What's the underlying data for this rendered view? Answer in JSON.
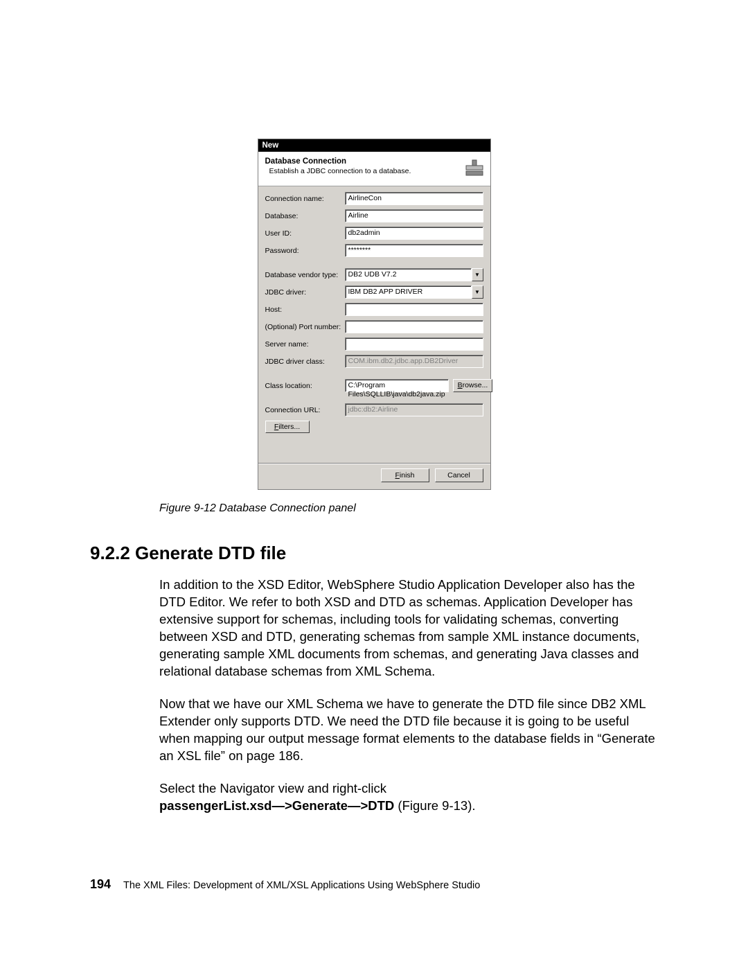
{
  "dialog": {
    "title": "New",
    "bannerTitle": "Database Connection",
    "bannerSubtitle": "Establish a JDBC connection to a database.",
    "labels": {
      "connName": "Connection name:",
      "database": "Database:",
      "userId": "User ID:",
      "password": "Password:",
      "vendor": "Database vendor type:",
      "jdbcDriver": "JDBC driver:",
      "host": "Host:",
      "port": "(Optional) Port number:",
      "server": "Server name:",
      "driverClass": "JDBC driver class:",
      "classLoc": "Class location:",
      "connUrl": "Connection URL:"
    },
    "values": {
      "connName": "AirlineCon",
      "database": "Airline",
      "userId": "db2admin",
      "password": "********",
      "vendor": "DB2 UDB V7.2",
      "jdbcDriver": "IBM DB2 APP DRIVER",
      "host": "",
      "port": "",
      "server": "",
      "driverClass": "COM.ibm.db2.jdbc.app.DB2Driver",
      "classLoc": "C:\\Program Files\\SQLLIB\\java\\db2java.zip",
      "connUrl": "jdbc:db2:Airline"
    },
    "buttons": {
      "browse": "Browse...",
      "filters": "Filters...",
      "finishPrefix": "F",
      "finishRest": "inish",
      "cancel": "Cancel"
    }
  },
  "figureCaption": "Figure 9-12   Database Connection panel",
  "sectionHeading": "9.2.2  Generate DTD file",
  "para1": "In addition to the XSD Editor, WebSphere Studio Application Developer also has the DTD Editor. We refer to both XSD and DTD as schemas. Application Developer has extensive support for schemas, including tools for validating schemas, converting between XSD and DTD, generating schemas from sample XML instance documents, generating sample XML documents from schemas, and generating Java classes and relational database schemas from XML Schema.",
  "para2": "Now that we have our XML Schema we have to generate the DTD file since DB2 XML Extender only supports DTD. We need the DTD file because it is going to be useful when mapping our output message format elements to the database fields in  “Generate an XSL file” on page 186.",
  "para3a": "Select the Navigator view and right-click ",
  "para3bold": "passengerList.xsd—>Generate—>DTD",
  "para3b": " (Figure 9-13).",
  "footerPage": "194",
  "footerTitle": "The XML Files:  Development of XML/XSL Applications Using WebSphere Studio"
}
